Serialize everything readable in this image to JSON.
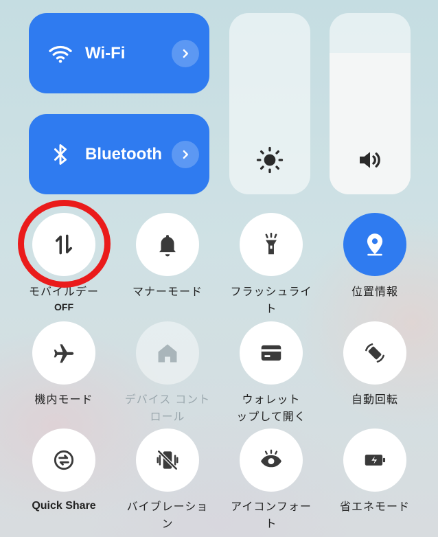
{
  "wifi": {
    "label": "Wi-Fi",
    "icon": "wifi-icon",
    "chevron": "chevron-right-icon"
  },
  "bluetooth": {
    "label": "Bluetooth",
    "icon": "bluetooth-icon",
    "chevron": "chevron-right-icon"
  },
  "brightness": {
    "icon": "brightness-icon",
    "level": 0.0
  },
  "volume": {
    "icon": "volume-icon",
    "level": 0.78
  },
  "accent_color": "#2f7bf0",
  "annotation_color": "#ea1b1b",
  "toggles": [
    {
      "label": "モバイルデー",
      "sub": "OFF",
      "icon": "mobile-data-icon",
      "state": "off"
    },
    {
      "label": "マナーモード",
      "icon": "bell-icon",
      "state": "off"
    },
    {
      "label": "フラッシュライト",
      "icon": "flashlight-icon",
      "state": "off"
    },
    {
      "label": "位置情報",
      "icon": "location-icon",
      "state": "on"
    },
    {
      "label": "機内モード",
      "icon": "airplane-icon",
      "state": "off"
    },
    {
      "label": "デバイス コントロール",
      "icon": "home-icon",
      "state": "disabled"
    },
    {
      "label": "ウォレット",
      "sub_label": "ップして開く",
      "icon": "wallet-icon",
      "state": "off"
    },
    {
      "label": "自動回転",
      "icon": "auto-rotate-icon",
      "state": "off"
    },
    {
      "label": "Quick Share",
      "icon": "quick-share-icon",
      "state": "off"
    },
    {
      "label": "バイブレーション",
      "icon": "vibration-icon",
      "state": "off"
    },
    {
      "label": "アイコンフォート",
      "icon": "eye-comfort-icon",
      "state": "off"
    },
    {
      "label": "省エネモード",
      "icon": "battery-saver-icon",
      "state": "off"
    }
  ]
}
